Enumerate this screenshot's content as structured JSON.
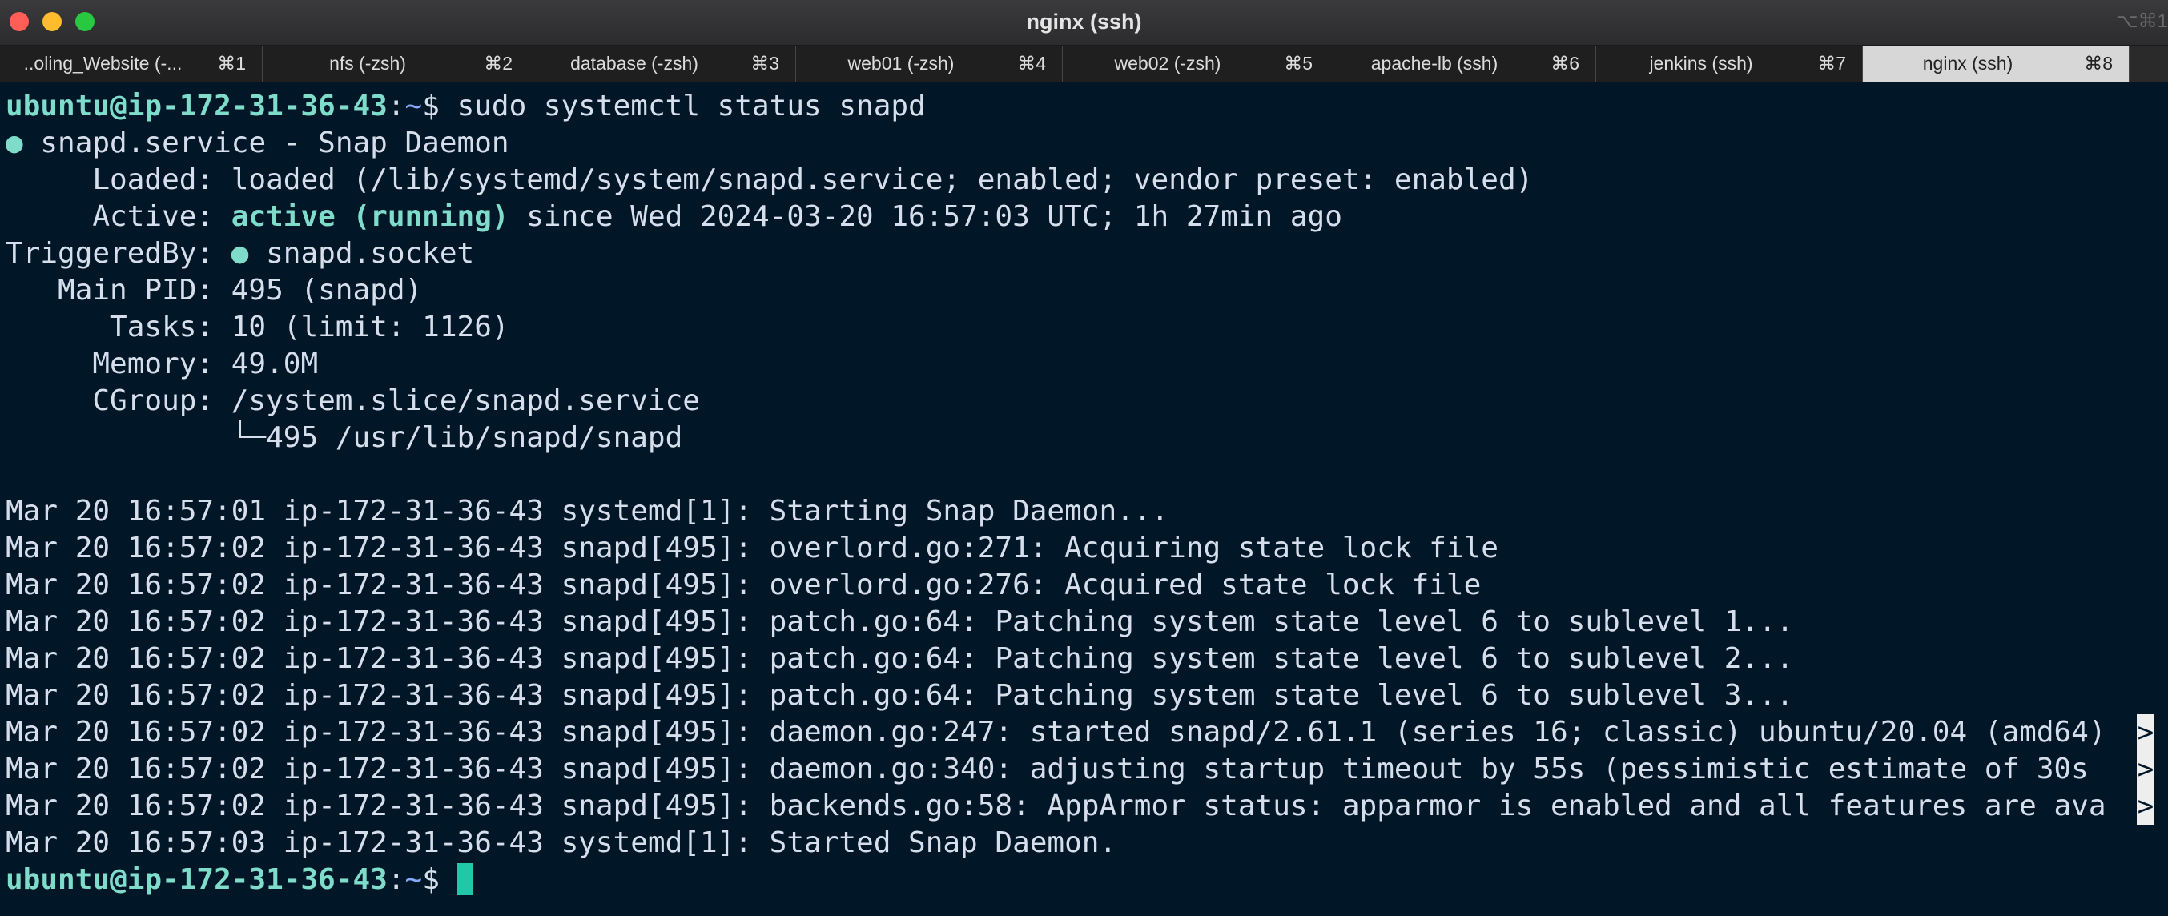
{
  "window": {
    "title": "nginx (ssh)",
    "corner_shortcut": "⌥⌘1"
  },
  "tabs": [
    {
      "label": "..oling_Website (-...",
      "shortcut": "⌘1"
    },
    {
      "label": "nfs (-zsh)",
      "shortcut": "⌘2"
    },
    {
      "label": "database (-zsh)",
      "shortcut": "⌘3"
    },
    {
      "label": "web01 (-zsh)",
      "shortcut": "⌘4"
    },
    {
      "label": "web02 (-zsh)",
      "shortcut": "⌘5"
    },
    {
      "label": "apache-lb (ssh)",
      "shortcut": "⌘6"
    },
    {
      "label": "jenkins (ssh)",
      "shortcut": "⌘7"
    },
    {
      "label": "nginx (ssh)",
      "shortcut": "⌘8",
      "active": true
    }
  ],
  "prompt": {
    "user_host": "ubuntu@ip-172-31-36-43",
    "sep": ":",
    "path": "~",
    "symbol": "$ "
  },
  "command": "sudo systemctl status snapd",
  "status": {
    "dot": "●",
    "header": " snapd.service - Snap Daemon",
    "loaded": "     Loaded: loaded (/lib/systemd/system/snapd.service; enabled; vendor preset: enabled)",
    "active_label": "     Active: ",
    "active_state": "active (running)",
    "active_since": " since Wed 2024-03-20 16:57:03 UTC; 1h 27min ago",
    "triggered_label": "TriggeredBy: ",
    "triggered_value": " snapd.socket",
    "main_pid": "   Main PID: 495 (snapd)",
    "tasks": "      Tasks: 10 (limit: 1126)",
    "memory": "     Memory: 49.0M",
    "cgroup": "     CGroup: /system.slice/snapd.service",
    "cgroup_child": "             └─495 /usr/lib/snapd/snapd"
  },
  "log": [
    "Mar 20 16:57:01 ip-172-31-36-43 systemd[1]: Starting Snap Daemon...",
    "Mar 20 16:57:02 ip-172-31-36-43 snapd[495]: overlord.go:271: Acquiring state lock file",
    "Mar 20 16:57:02 ip-172-31-36-43 snapd[495]: overlord.go:276: Acquired state lock file",
    "Mar 20 16:57:02 ip-172-31-36-43 snapd[495]: patch.go:64: Patching system state level 6 to sublevel 1...",
    "Mar 20 16:57:02 ip-172-31-36-43 snapd[495]: patch.go:64: Patching system state level 6 to sublevel 2...",
    "Mar 20 16:57:02 ip-172-31-36-43 snapd[495]: patch.go:64: Patching system state level 6 to sublevel 3...",
    "Mar 20 16:57:02 ip-172-31-36-43 snapd[495]: daemon.go:247: started snapd/2.61.1 (series 16; classic) ubuntu/20.04 (amd64)",
    "Mar 20 16:57:02 ip-172-31-36-43 snapd[495]: daemon.go:340: adjusting startup timeout by 55s (pessimistic estimate of 30s",
    "Mar 20 16:57:02 ip-172-31-36-43 snapd[495]: backends.go:58: AppArmor status: apparmor is enabled and all features are ava",
    "Mar 20 16:57:03 ip-172-31-36-43 systemd[1]: Started Snap Daemon."
  ],
  "truncation_marker": ">",
  "colors": {
    "background": "#011627",
    "accent": "#7fdbca",
    "cursor": "#21c7a8",
    "path": "#82aaff"
  }
}
